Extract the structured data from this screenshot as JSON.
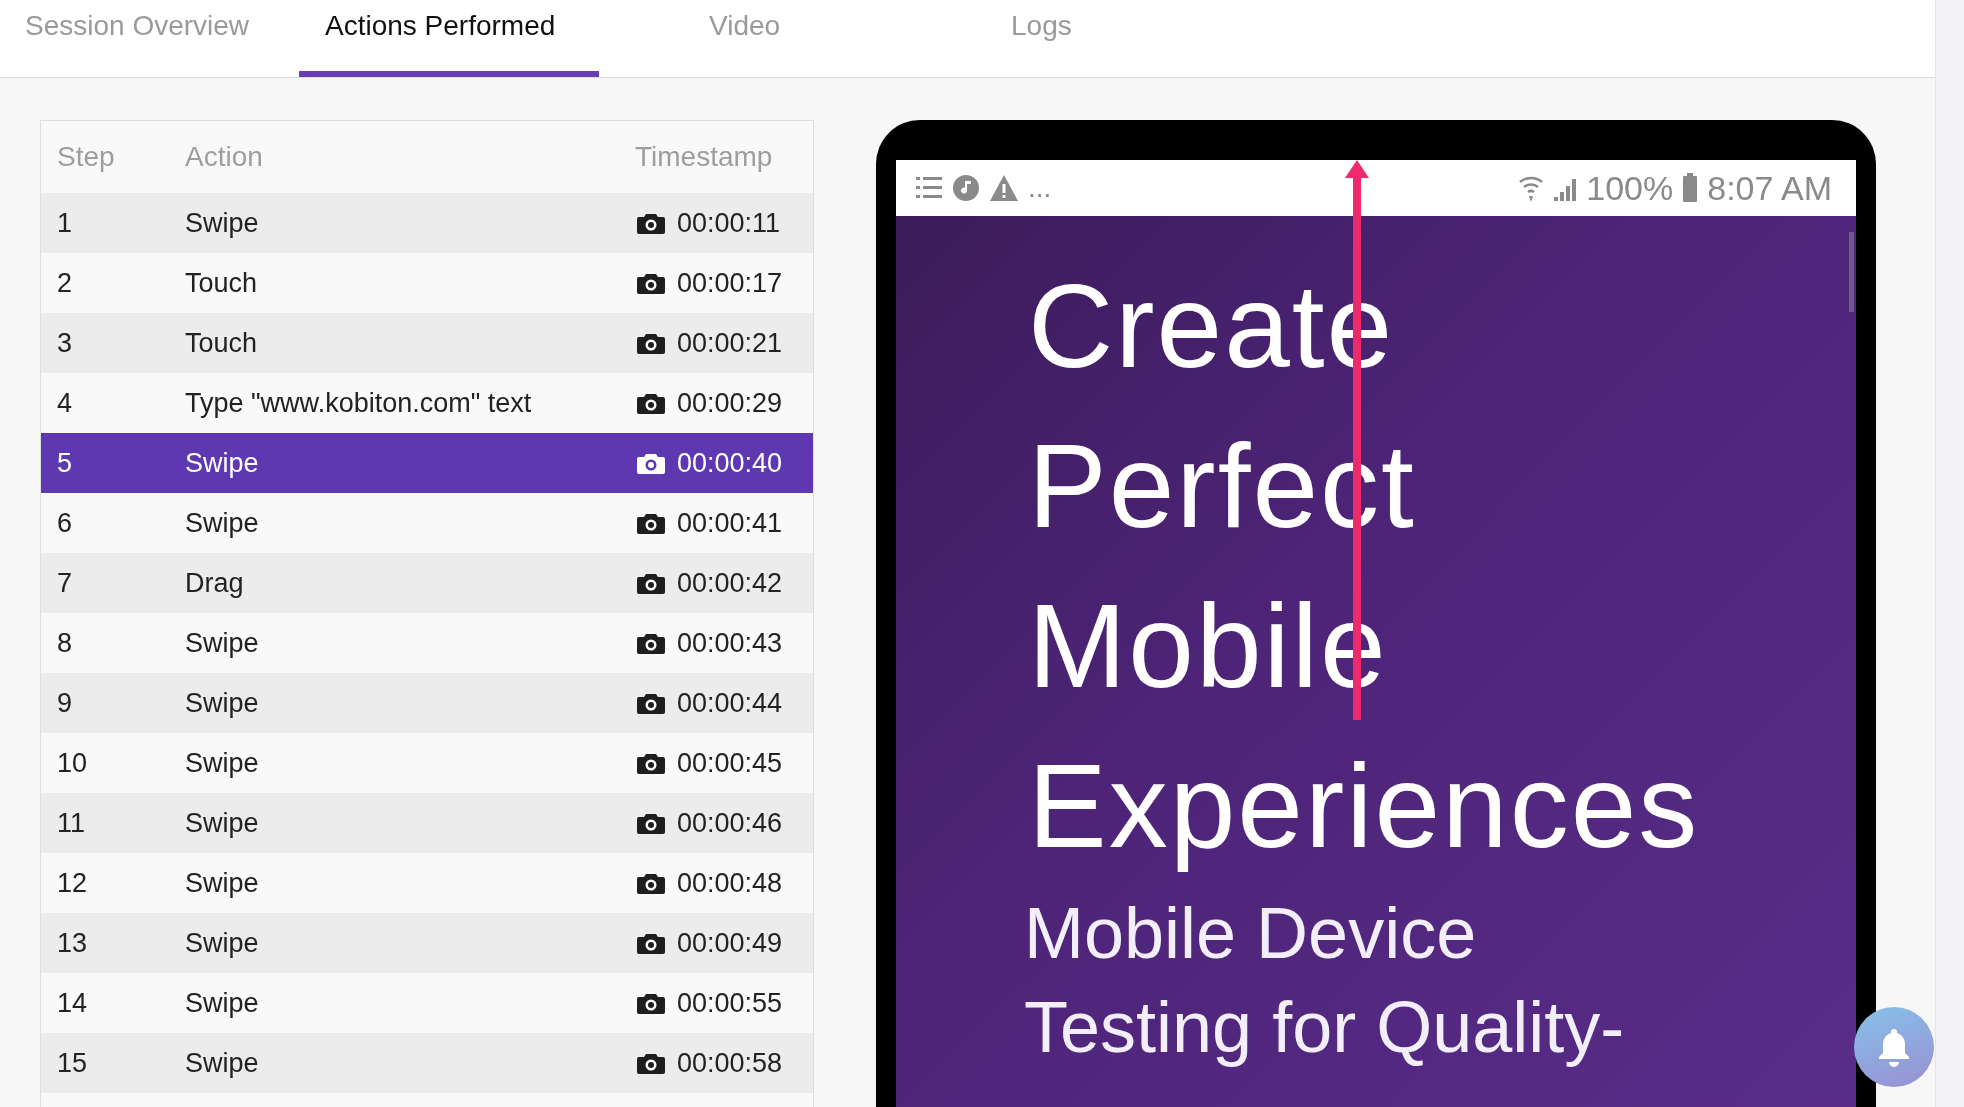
{
  "tabs": [
    {
      "label": "Session Overview",
      "selected": false
    },
    {
      "label": "Actions Performed",
      "selected": true
    },
    {
      "label": "Video",
      "selected": false
    },
    {
      "label": "Logs",
      "selected": false
    }
  ],
  "table": {
    "columns": [
      "Step",
      "Action",
      "Timestamp"
    ],
    "rows": [
      {
        "step": "1",
        "action": "Swipe",
        "timestamp": "00:00:11",
        "selected": false
      },
      {
        "step": "2",
        "action": "Touch",
        "timestamp": "00:00:17",
        "selected": false
      },
      {
        "step": "3",
        "action": "Touch",
        "timestamp": "00:00:21",
        "selected": false
      },
      {
        "step": "4",
        "action": "Type \"www.kobiton.com\" text",
        "timestamp": "00:00:29",
        "selected": false
      },
      {
        "step": "5",
        "action": "Swipe",
        "timestamp": "00:00:40",
        "selected": true
      },
      {
        "step": "6",
        "action": "Swipe",
        "timestamp": "00:00:41",
        "selected": false
      },
      {
        "step": "7",
        "action": "Drag",
        "timestamp": "00:00:42",
        "selected": false
      },
      {
        "step": "8",
        "action": "Swipe",
        "timestamp": "00:00:43",
        "selected": false
      },
      {
        "step": "9",
        "action": "Swipe",
        "timestamp": "00:00:44",
        "selected": false
      },
      {
        "step": "10",
        "action": "Swipe",
        "timestamp": "00:00:45",
        "selected": false
      },
      {
        "step": "11",
        "action": "Swipe",
        "timestamp": "00:00:46",
        "selected": false
      },
      {
        "step": "12",
        "action": "Swipe",
        "timestamp": "00:00:48",
        "selected": false
      },
      {
        "step": "13",
        "action": "Swipe",
        "timestamp": "00:00:49",
        "selected": false
      },
      {
        "step": "14",
        "action": "Swipe",
        "timestamp": "00:00:55",
        "selected": false
      },
      {
        "step": "15",
        "action": "Swipe",
        "timestamp": "00:00:58",
        "selected": false
      }
    ]
  },
  "device": {
    "status_bar": {
      "more": "...",
      "battery": "100%",
      "time": "8:07 AM"
    },
    "screen_lines": [
      {
        "text": "Create",
        "kind": "headline"
      },
      {
        "text": "Perfect",
        "kind": "headline"
      },
      {
        "text": "Mobile",
        "kind": "headline"
      },
      {
        "text": "Experiences",
        "kind": "headline"
      },
      {
        "text": "Mobile Device",
        "kind": "subhead"
      },
      {
        "text": "Testing for Quality-",
        "kind": "subhead"
      }
    ]
  }
}
